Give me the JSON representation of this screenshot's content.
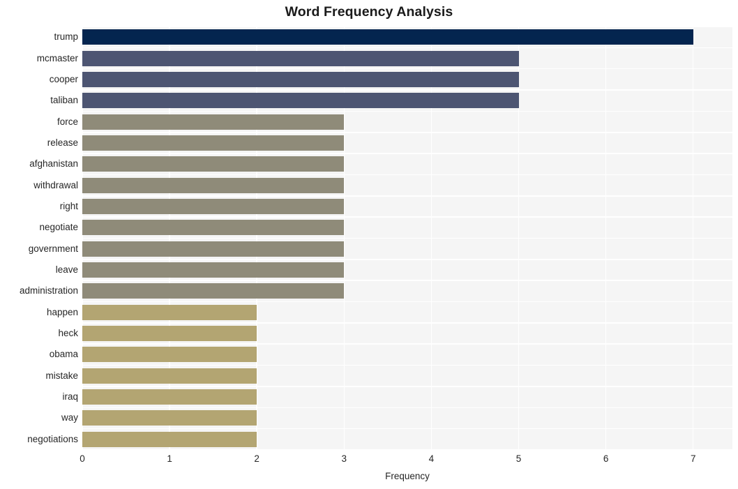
{
  "chart_data": {
    "type": "bar",
    "orientation": "horizontal",
    "title": "Word Frequency Analysis",
    "xlabel": "Frequency",
    "ylabel": "",
    "xlim": [
      0,
      7.45
    ],
    "xticks": [
      0,
      1,
      2,
      3,
      4,
      5,
      6,
      7
    ],
    "xtick_labels": [
      "0",
      "1",
      "2",
      "3",
      "4",
      "5",
      "6",
      "7"
    ],
    "grid": true,
    "legend": "none",
    "categories": [
      "trump",
      "mcmaster",
      "cooper",
      "taliban",
      "force",
      "release",
      "afghanistan",
      "withdrawal",
      "right",
      "negotiate",
      "government",
      "leave",
      "administration",
      "happen",
      "heck",
      "obama",
      "mistake",
      "iraq",
      "way",
      "negotiations"
    ],
    "values": [
      7,
      5,
      5,
      5,
      3,
      3,
      3,
      3,
      3,
      3,
      3,
      3,
      3,
      2,
      2,
      2,
      2,
      2,
      2,
      2
    ],
    "bar_colors": [
      "#04254f",
      "#4d5572",
      "#4d5572",
      "#4d5572",
      "#8f8b79",
      "#8f8b79",
      "#8f8b79",
      "#8f8b79",
      "#8f8b79",
      "#8f8b79",
      "#8f8b79",
      "#8f8b79",
      "#8f8b79",
      "#b3a572",
      "#b3a572",
      "#b3a572",
      "#b3a572",
      "#b3a572",
      "#b3a572",
      "#b3a572"
    ]
  },
  "style": {
    "plot_background": "#f5f5f5",
    "figure_background": "#ffffff",
    "gridline_color": "#ffffff",
    "tick_label_color": "#262626",
    "title_color": "#1a1a1a"
  }
}
